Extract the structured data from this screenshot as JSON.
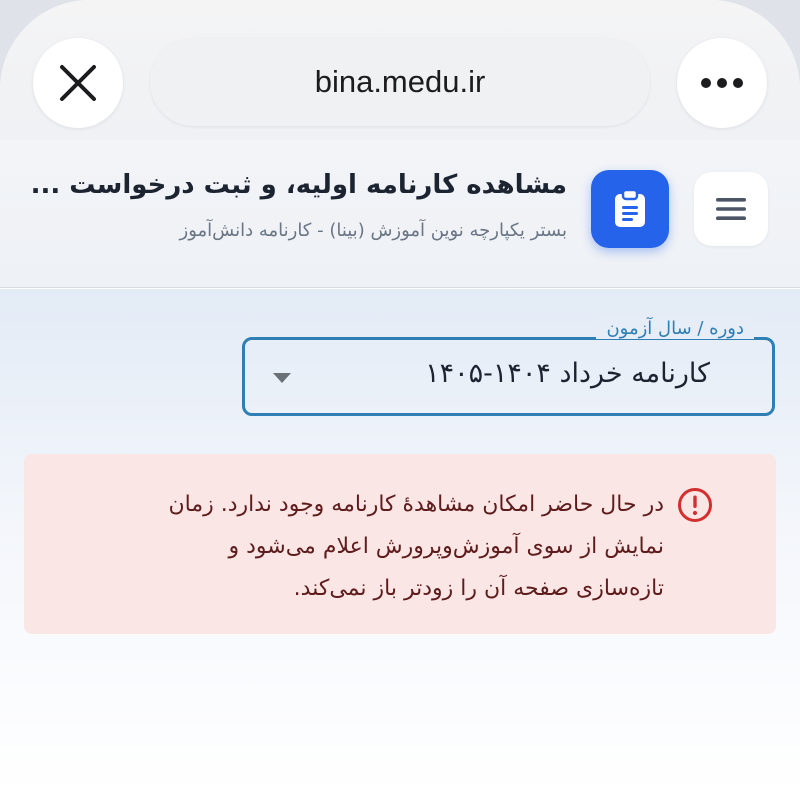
{
  "browser": {
    "url": "bina.medu.ir",
    "close_icon": "close-icon",
    "more_icon": "more-icon"
  },
  "header": {
    "title": "مشاهده کارنامه اولیه، و ثبت درخواست ...",
    "subtitle": "بستر یکپارچه نوین آموزش (بینا) - کارنامه دانش‌آموز",
    "app_icon": "clipboard-icon",
    "menu_icon": "hamburger-menu-icon",
    "accent": "#2563eb"
  },
  "period_select": {
    "label": "دوره / سال آزمون",
    "value": "کارنامه خرداد ۱۴۰۴-۱۴۰۵",
    "accent": "#2e7fb3"
  },
  "alert": {
    "lines": [
      "در حال حاضر امکان مشاهدهٔ کارنامه وجود ندارد. زمان",
      "نمایش از سوی آموزش‌وپرورش اعلام می‌شود و",
      "تازه‌سازی صفحه آن را زودتر باز نمی‌کند."
    ],
    "icon": "error-circle-icon",
    "background": "#fbe6e6",
    "icon_color": "#d32f2f"
  }
}
